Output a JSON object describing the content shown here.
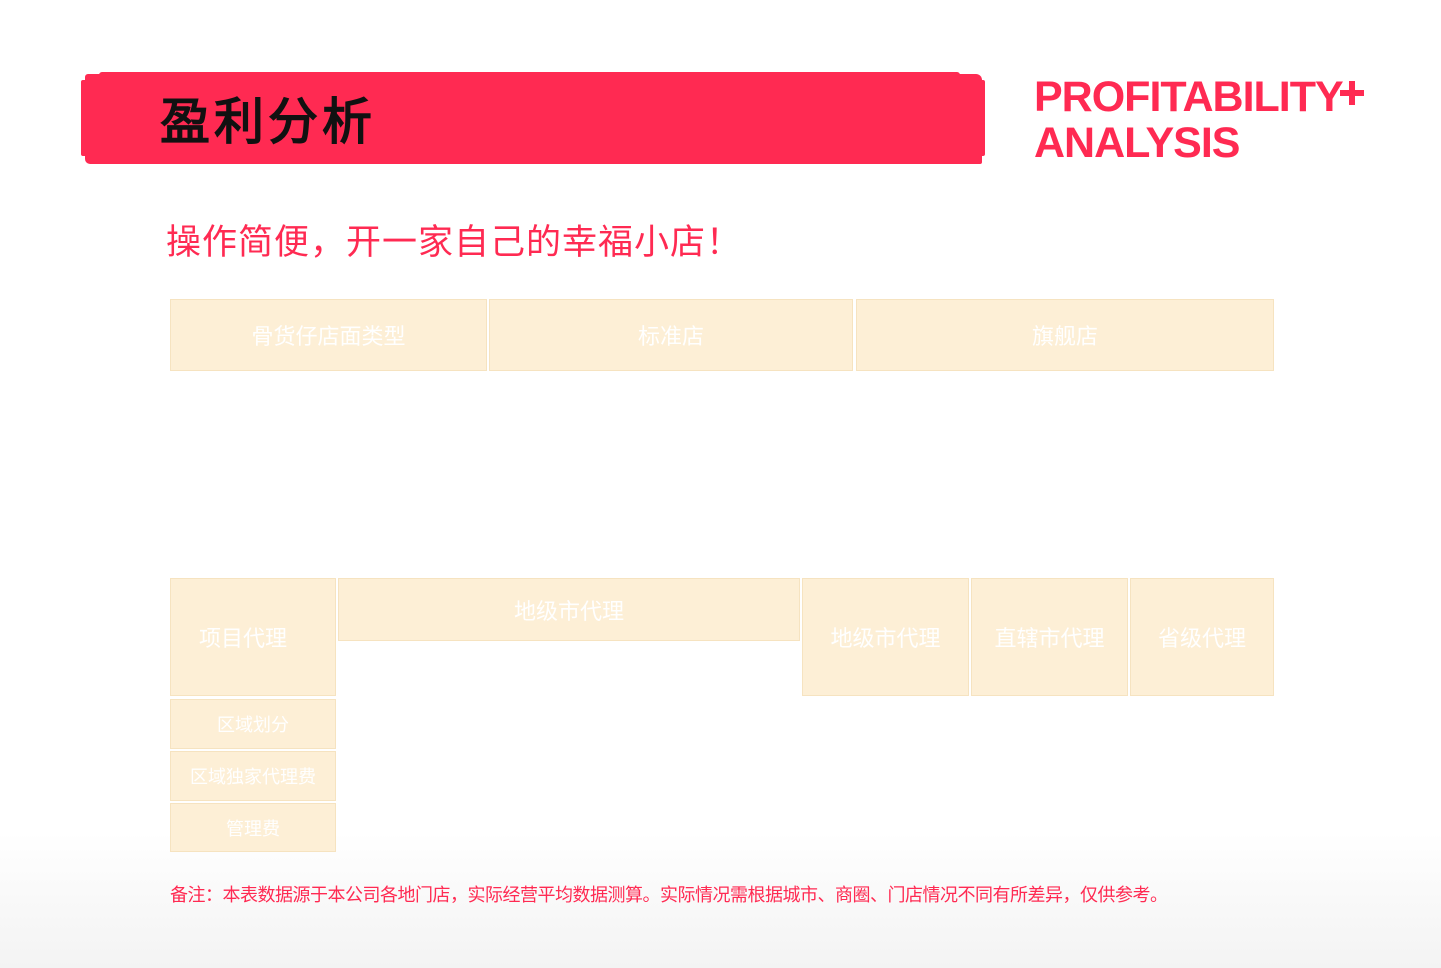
{
  "header": {
    "title_cn": "盈利分析",
    "title_en_line1": "PROFITABILITY",
    "title_en_line2": "ANALYSIS",
    "accent_color": "#ff2a52",
    "plus_icon": "plus-icon"
  },
  "subtitle": "操作简便，开一家自己的幸福小店！",
  "table1": {
    "headers": [
      "骨货仔店面类型",
      "标准店",
      "旗舰店"
    ]
  },
  "table2": {
    "headers": [
      "项目代理",
      "地级市代理",
      "地级市代理",
      "直辖市代理",
      "省级代理"
    ],
    "rows": [
      "区域划分",
      "区域独家代理费",
      "管理费"
    ]
  },
  "note": "备注：本表数据源于本公司各地门店，实际经营平均数据测算。实际情况需根据城市、商圈、门店情况不同有所差异，仅供参考。",
  "colors": {
    "header_cell_bg": "#fdefd6",
    "brand_red": "#ff2a52"
  }
}
